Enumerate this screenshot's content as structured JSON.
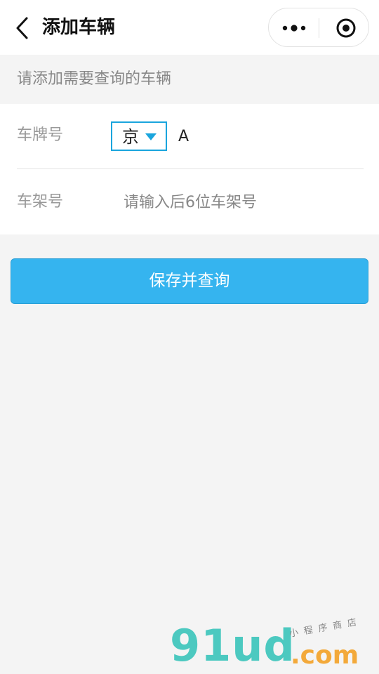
{
  "nav": {
    "title": "添加车辆"
  },
  "hint": "请添加需要查询的车辆",
  "form": {
    "plate_label": "车牌号",
    "province": "京",
    "plate_value": "A",
    "frame_label": "车架号",
    "frame_placeholder": "请输入后6位车架号",
    "frame_value": ""
  },
  "submit_label": "保存并查询",
  "watermark": {
    "logo": "91ud",
    "suffix": ".com",
    "tagline": "小程序商店"
  },
  "colors": {
    "accent": "#35b4ef",
    "select_border": "#1aa5dd",
    "background": "#f4f4f4",
    "watermark_teal": "#4cc9c0",
    "watermark_orange": "#f3a93a"
  },
  "icons": {
    "back": "chevron-left-icon",
    "menu": "more-dots-icon",
    "close": "target-circle-icon",
    "caret": "caret-down-icon"
  }
}
